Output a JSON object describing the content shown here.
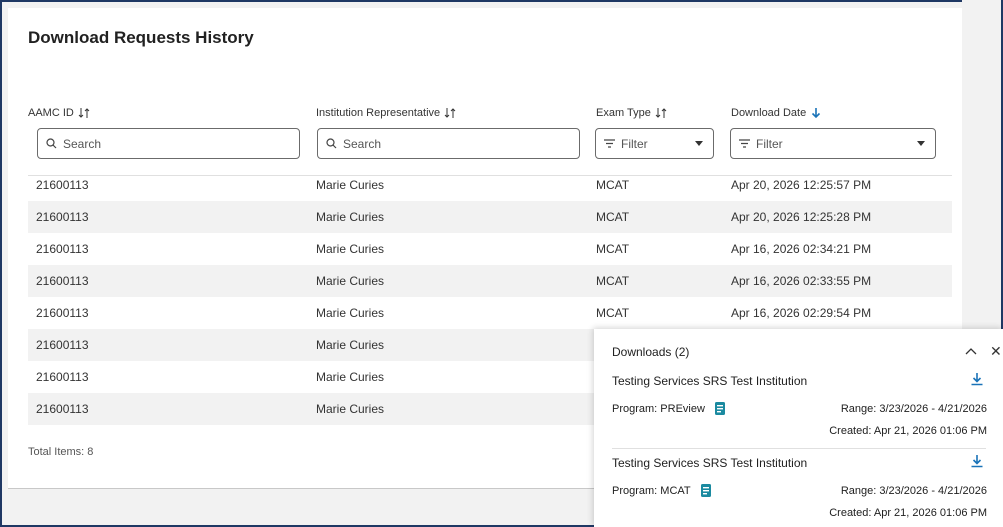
{
  "page": {
    "title": "Download Requests History"
  },
  "columns": [
    {
      "label": "AAMC ID",
      "sort": "both"
    },
    {
      "label": "Institution Representative",
      "sort": "both"
    },
    {
      "label": "Exam Type",
      "sort": "both"
    },
    {
      "label": "Download Date",
      "sort": "desc"
    }
  ],
  "filters": {
    "aamc_id_placeholder": "Search",
    "rep_placeholder": "Search",
    "exam_type_value": "Filter",
    "download_date_value": "Filter"
  },
  "rows": [
    {
      "id": "21600113",
      "rep": "Marie Curies",
      "exam": "MCAT",
      "date": "Apr 20, 2026 12:25:57 PM"
    },
    {
      "id": "21600113",
      "rep": "Marie Curies",
      "exam": "MCAT",
      "date": "Apr 20, 2026 12:25:28 PM"
    },
    {
      "id": "21600113",
      "rep": "Marie Curies",
      "exam": "MCAT",
      "date": "Apr 16, 2026 02:34:21 PM"
    },
    {
      "id": "21600113",
      "rep": "Marie Curies",
      "exam": "MCAT",
      "date": "Apr 16, 2026 02:33:55 PM"
    },
    {
      "id": "21600113",
      "rep": "Marie Curies",
      "exam": "MCAT",
      "date": "Apr 16, 2026 02:29:54 PM"
    },
    {
      "id": "21600113",
      "rep": "Marie Curies",
      "exam": "",
      "date": ""
    },
    {
      "id": "21600113",
      "rep": "Marie Curies",
      "exam": "",
      "date": ""
    },
    {
      "id": "21600113",
      "rep": "Marie Curies",
      "exam": "",
      "date": ""
    }
  ],
  "footer": {
    "total": "Total Items: 8"
  },
  "downloads": {
    "title": "Downloads (2)",
    "items": [
      {
        "institution": "Testing Services SRS Test Institution",
        "program": "Program: PREview",
        "range": "Range: 3/23/2026 - 4/21/2026",
        "created": "Created: Apr 21, 2026 01:06 PM"
      },
      {
        "institution": "Testing Services SRS Test Institution",
        "program": "Program: MCAT",
        "range": "Range: 3/23/2026 - 4/21/2026",
        "created": "Created: Apr 21, 2026 01:06 PM"
      }
    ]
  },
  "colors": {
    "accent": "#1a73b8",
    "frame": "#1f3864",
    "teal": "#1b8aa0"
  }
}
